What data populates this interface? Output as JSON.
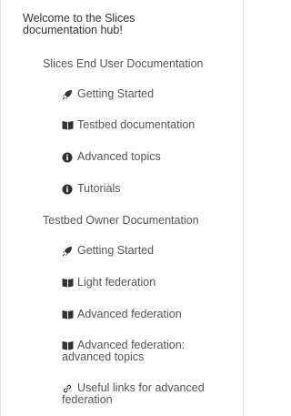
{
  "sidebar": {
    "title": "Welcome to the Slices documentation hub!",
    "sections": [
      {
        "label": "Slices End User Documentation",
        "items": [
          {
            "icon": "rocket-icon",
            "label": "Getting Started"
          },
          {
            "icon": "book-icon",
            "label": "Testbed documentation"
          },
          {
            "icon": "info-icon",
            "label": "Advanced topics"
          },
          {
            "icon": "info-icon",
            "label": "Tutorials"
          }
        ]
      },
      {
        "label": "Testbed Owner Documentation",
        "items": [
          {
            "icon": "rocket-icon",
            "label": "Getting Started"
          },
          {
            "icon": "book-icon",
            "label": "Light federation"
          },
          {
            "icon": "book-icon",
            "label": "Advanced federation"
          },
          {
            "icon": "book-icon",
            "label": "Advanced federation: advanced topics"
          },
          {
            "icon": "link-icon",
            "label": "Useful links for advanced federation"
          }
        ]
      }
    ]
  }
}
